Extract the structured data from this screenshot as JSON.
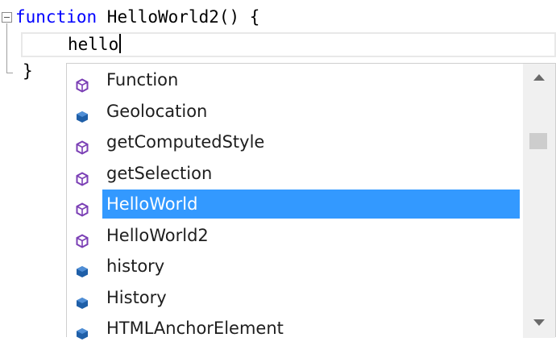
{
  "editor": {
    "line1_keyword": "function",
    "line1_rest": " HelloWorld2() {",
    "typed_text": "hello",
    "line3": "}"
  },
  "completion": {
    "items": [
      {
        "label": "Function",
        "icon": "function-icon",
        "selected": false
      },
      {
        "label": "Geolocation",
        "icon": "object-icon",
        "selected": false
      },
      {
        "label": "getComputedStyle",
        "icon": "function-icon",
        "selected": false
      },
      {
        "label": "getSelection",
        "icon": "function-icon",
        "selected": false
      },
      {
        "label": "HelloWorld",
        "icon": "function-icon",
        "selected": true
      },
      {
        "label": "HelloWorld2",
        "icon": "function-icon",
        "selected": false
      },
      {
        "label": "history",
        "icon": "object-icon",
        "selected": false
      },
      {
        "label": "History",
        "icon": "object-icon",
        "selected": false
      },
      {
        "label": "HTMLAnchorElement",
        "icon": "object-icon",
        "selected": false
      }
    ]
  },
  "colors": {
    "keyword": "#0000ff",
    "selection": "#3399ff",
    "function_icon": "#7b3fb5",
    "object_icon": "#1f5fa8"
  }
}
